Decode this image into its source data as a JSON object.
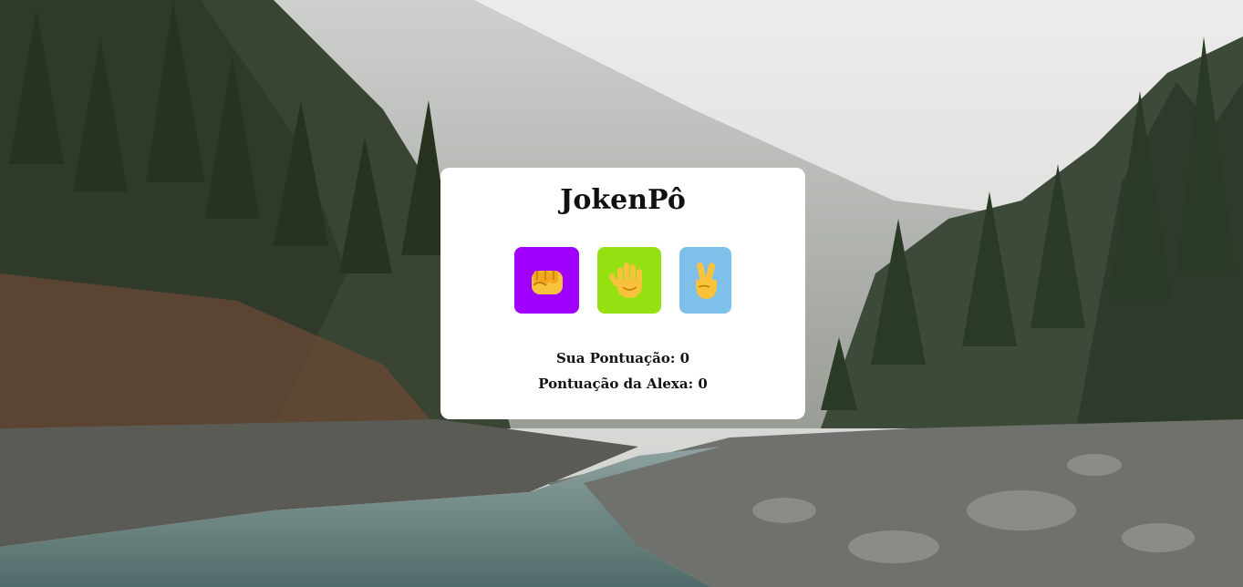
{
  "game": {
    "title": "JokenPô",
    "choices": [
      {
        "name": "rock",
        "icon": "fist-icon",
        "color": "#a100ff"
      },
      {
        "name": "paper",
        "icon": "raised-hand-icon",
        "color": "#95e011"
      },
      {
        "name": "scissors",
        "icon": "victory-hand-icon",
        "color": "#7fc0ea"
      }
    ],
    "user_score_label": "Sua Pontuação: 0",
    "alexa_score_label": "Pontuação da Alexa: 0"
  },
  "background": {
    "description_icon": "forest-river-background"
  }
}
